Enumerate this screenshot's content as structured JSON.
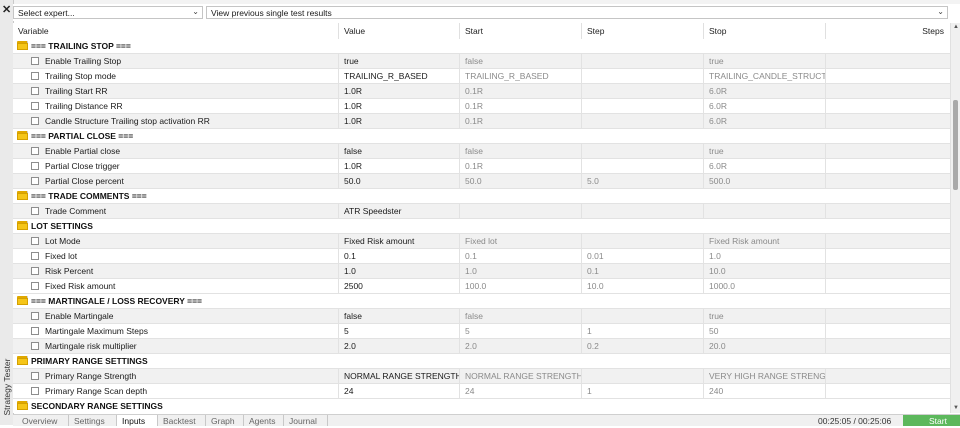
{
  "window": {
    "side_label": "Strategy Tester"
  },
  "toolbar": {
    "expert_select": "Select expert...",
    "results_select": "View previous single test results"
  },
  "columns": [
    "Variable",
    "Value",
    "Start",
    "Step",
    "Stop",
    "Steps"
  ],
  "rows": [
    {
      "type": "group",
      "title": "=== TRAILING STOP ==="
    },
    {
      "type": "param",
      "name": "Enable Trailing Stop",
      "value": "true",
      "start": "false",
      "step": "",
      "stop": "true"
    },
    {
      "type": "param",
      "name": "Trailing Stop mode",
      "value": "TRAILING_R_BASED",
      "start": "TRAILING_R_BASED",
      "step": "",
      "stop": "TRAILING_CANDLE_STRUCT..."
    },
    {
      "type": "param",
      "name": "Trailing Start RR",
      "value": "1.0R",
      "start": "0.1R",
      "step": "",
      "stop": "6.0R"
    },
    {
      "type": "param",
      "name": "Trailing Distance RR",
      "value": "1.0R",
      "start": "0.1R",
      "step": "",
      "stop": "6.0R"
    },
    {
      "type": "param",
      "name": "Candle Structure Trailing stop activation RR",
      "value": "1.0R",
      "start": "0.1R",
      "step": "",
      "stop": "6.0R"
    },
    {
      "type": "group",
      "title": "=== PARTIAL CLOSE ==="
    },
    {
      "type": "param",
      "name": "Enable Partial close",
      "value": "false",
      "start": "false",
      "step": "",
      "stop": "true"
    },
    {
      "type": "param",
      "name": "Partial Close trigger",
      "value": "1.0R",
      "start": "0.1R",
      "step": "",
      "stop": "6.0R"
    },
    {
      "type": "param",
      "name": "Partial Close percent",
      "value": "50.0",
      "start": "50.0",
      "step": "5.0",
      "stop": "500.0"
    },
    {
      "type": "group",
      "title": "=== TRADE COMMENTS ==="
    },
    {
      "type": "param",
      "name": "Trade Comment",
      "value": "ATR Speedster",
      "start": "",
      "step": "",
      "stop": ""
    },
    {
      "type": "group",
      "title": "LOT SETTINGS"
    },
    {
      "type": "param",
      "name": "Lot Mode",
      "value": "Fixed Risk amount",
      "start": "Fixed lot",
      "step": "",
      "stop": "Fixed Risk amount"
    },
    {
      "type": "param",
      "name": "Fixed lot",
      "value": "0.1",
      "start": "0.1",
      "step": "0.01",
      "stop": "1.0"
    },
    {
      "type": "param",
      "name": "Risk Percent",
      "value": "1.0",
      "start": "1.0",
      "step": "0.1",
      "stop": "10.0"
    },
    {
      "type": "param",
      "name": "Fixed Risk amount",
      "value": "2500",
      "start": "100.0",
      "step": "10.0",
      "stop": "1000.0"
    },
    {
      "type": "group",
      "title": "=== MARTINGALE / LOSS RECOVERY ==="
    },
    {
      "type": "param",
      "name": "Enable Martingale",
      "value": "false",
      "start": "false",
      "step": "",
      "stop": "true"
    },
    {
      "type": "param",
      "name": "Martingale Maximum Steps",
      "value": "5",
      "start": "5",
      "step": "1",
      "stop": "50"
    },
    {
      "type": "param",
      "name": "Martingale risk multiplier",
      "value": "2.0",
      "start": "2.0",
      "step": "0.2",
      "stop": "20.0"
    },
    {
      "type": "group",
      "title": "PRIMARY RANGE SETTINGS"
    },
    {
      "type": "param",
      "name": "Primary Range Strength",
      "value": "NORMAL RANGE STRENGTH",
      "start": "NORMAL RANGE STRENGTH",
      "step": "",
      "stop": "VERY HIGH RANGE STRENG..."
    },
    {
      "type": "param",
      "name": "Primary Range Scan depth",
      "value": "24",
      "start": "24",
      "step": "1",
      "stop": "240"
    },
    {
      "type": "group",
      "title": "SECONDARY RANGE SETTINGS"
    }
  ],
  "tabs": [
    "Overview",
    "Settings",
    "Inputs",
    "Backtest",
    "Graph",
    "Agents",
    "Journal"
  ],
  "active_tab": "Inputs",
  "status": {
    "time": "00:25:05 / 00:25:06",
    "start_button": "Start"
  },
  "colors": {
    "folder": "#f5c518",
    "start_button": "#5cb85c",
    "alt_row": "#f1f1f1"
  }
}
